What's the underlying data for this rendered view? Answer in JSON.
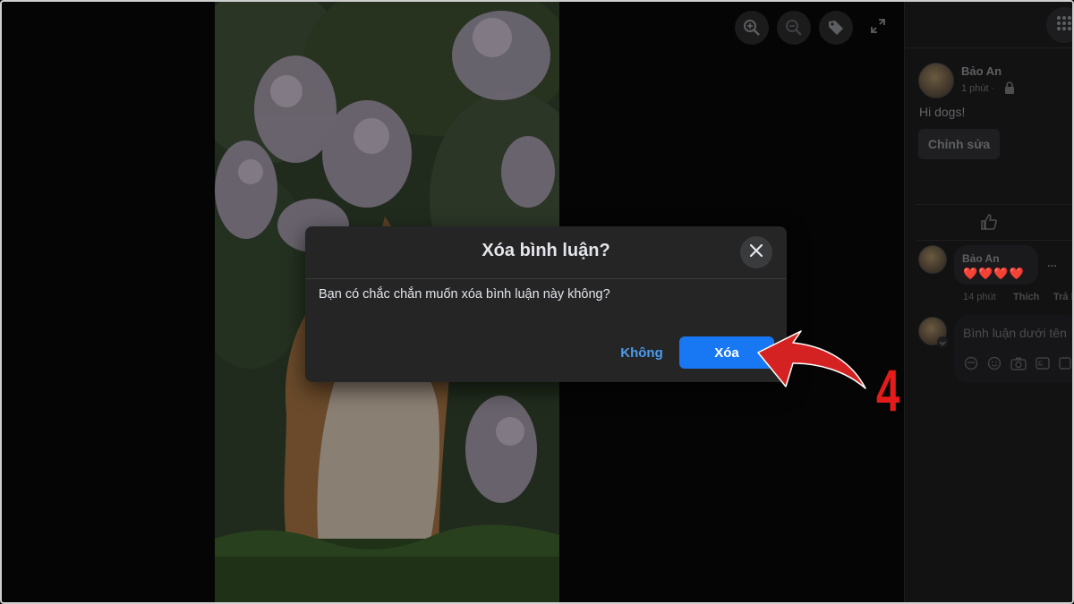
{
  "viewer": {
    "tools": [
      {
        "icon": "zoom-in-icon"
      },
      {
        "icon": "zoom-out-icon"
      },
      {
        "icon": "tag-icon"
      },
      {
        "icon": "expand-icon"
      }
    ]
  },
  "post": {
    "author": "Bảo An",
    "time": "1 phút ·",
    "privacy_icon": "lock-icon",
    "text": "Hi dogs!",
    "edit_label": "Chỉnh sửa"
  },
  "comment": {
    "author": "Bảo An",
    "content": "❤️❤️❤️❤️",
    "more": "...",
    "time": "14 phút",
    "like_label": "Thích",
    "reply_label": "Trả l"
  },
  "composer": {
    "placeholder": "Bình luận dưới tên"
  },
  "dialog": {
    "title": "Xóa bình luận?",
    "message": "Bạn có chắc chắn muốn xóa bình luận này không?",
    "cancel_label": "Không",
    "confirm_label": "Xóa"
  },
  "annotation": {
    "step_number": "4",
    "color": "#e31b1b"
  },
  "colors": {
    "primary_button": "#1877f2",
    "link": "#4a9cf0",
    "dialog_bg": "#252526"
  }
}
